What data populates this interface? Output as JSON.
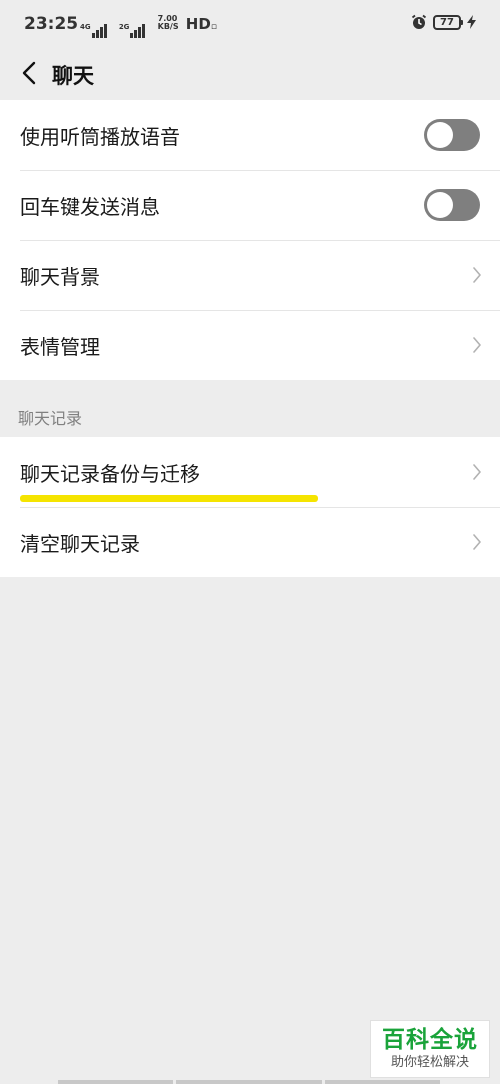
{
  "status_bar": {
    "time": "23:25",
    "sim1_tag": "4G",
    "sim2_tag": "2G",
    "speed_value": "7.00",
    "speed_unit": "KB/S",
    "hd": "HD",
    "battery": "77",
    "icons": [
      "alarm-icon",
      "battery-icon",
      "charging-bolt-icon"
    ]
  },
  "nav": {
    "title": "聊天",
    "back_icon": "chevron-left-icon"
  },
  "settings_group_1": {
    "items": [
      {
        "label": "使用听筒播放语音",
        "control": "toggle",
        "state": "off"
      },
      {
        "label": "回车键发送消息",
        "control": "toggle",
        "state": "off"
      },
      {
        "label": "聊天背景",
        "control": "chevron"
      },
      {
        "label": "表情管理",
        "control": "chevron"
      }
    ]
  },
  "chat_history_section": {
    "label": "聊天记录",
    "items": [
      {
        "label": "聊天记录备份与迁移",
        "control": "chevron",
        "highlighted": true
      },
      {
        "label": "清空聊天记录",
        "control": "chevron"
      }
    ]
  },
  "colors": {
    "background": "#ededed",
    "toggle_off": "#7f7f7f",
    "highlight": "#f5e400",
    "watermark_green": "#1aa33a"
  },
  "watermark": {
    "title": "百科全说",
    "subtitle": "助你轻松解决"
  }
}
